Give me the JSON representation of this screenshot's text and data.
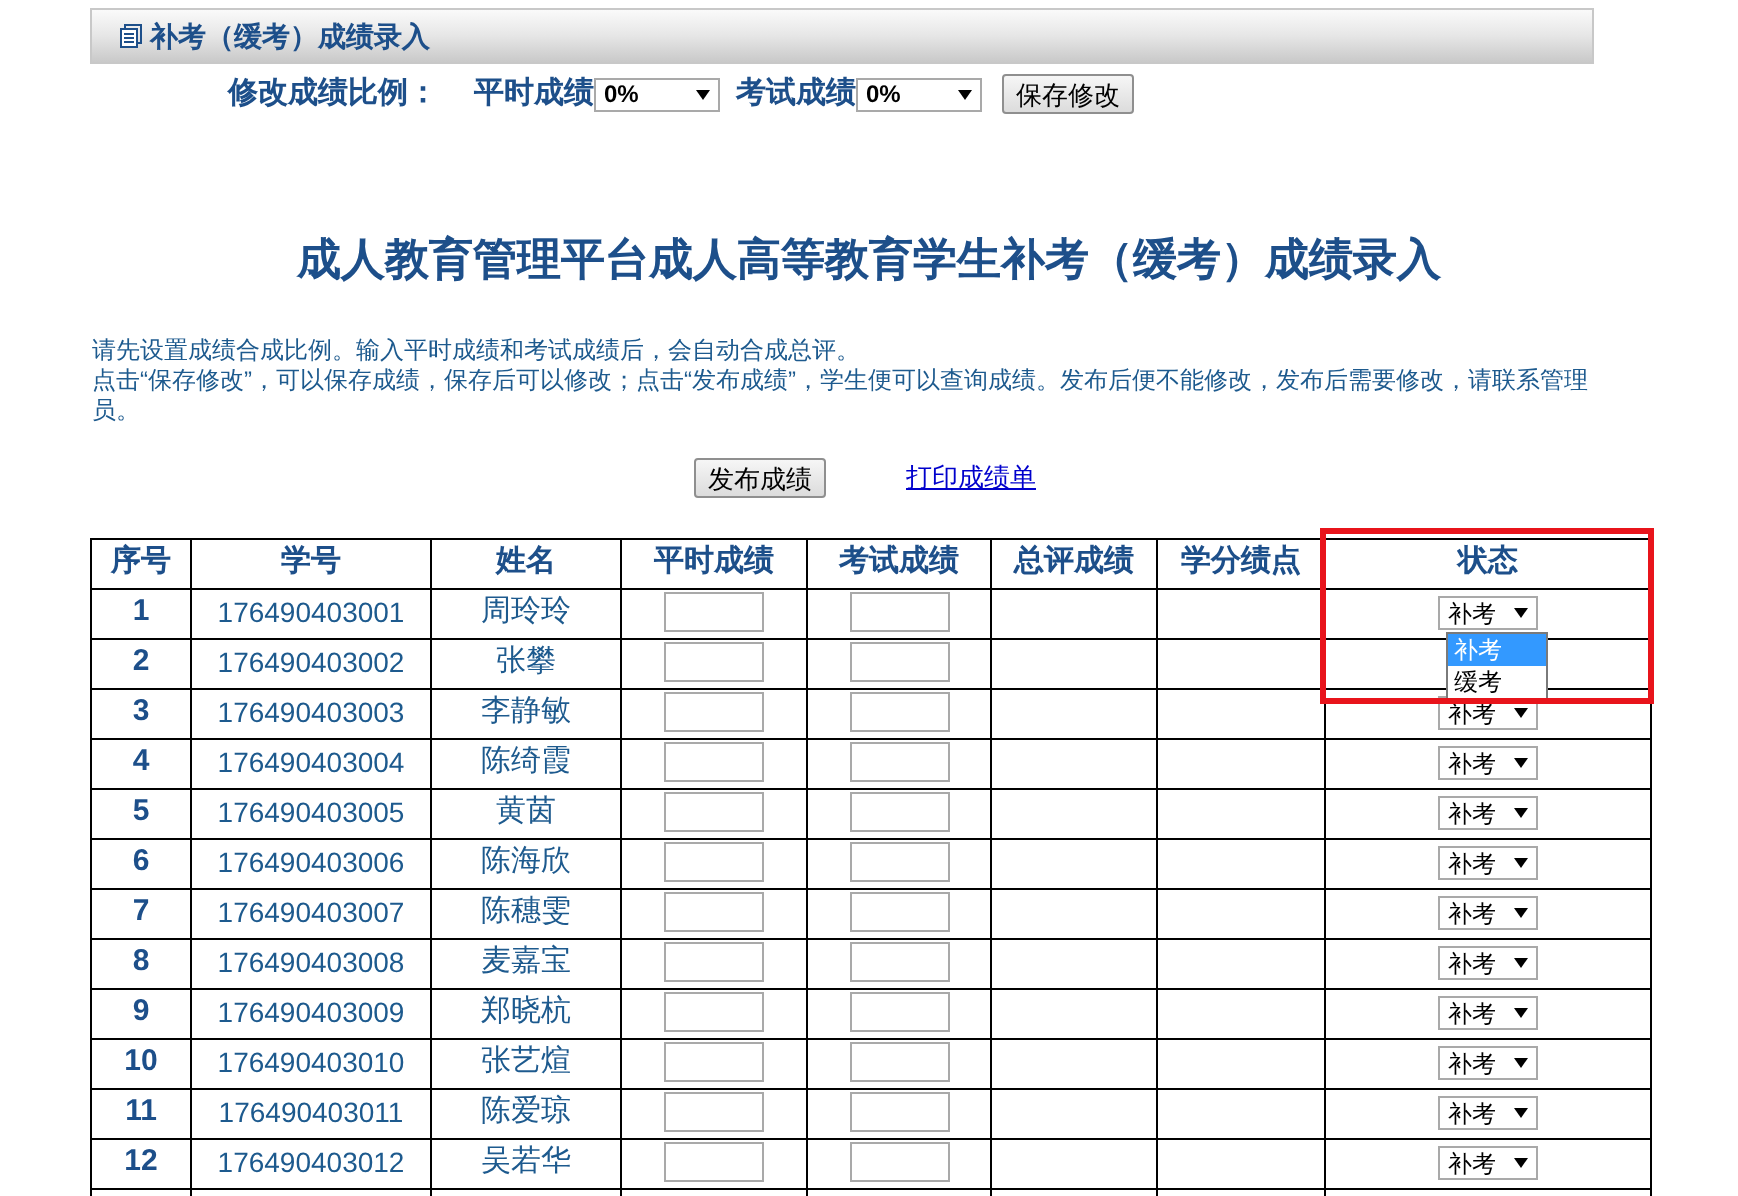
{
  "header": {
    "title": "补考（缓考）成绩录入"
  },
  "ratio": {
    "label": "修改成绩比例：",
    "fields": [
      {
        "label": "平时成绩",
        "value": "0%"
      },
      {
        "label": "考试成绩",
        "value": "0%"
      }
    ],
    "save_button": "保存修改"
  },
  "page_title": "成人教育管理平台成人高等教育学生补考（缓考）成绩录入",
  "instructions": [
    "请先设置成绩合成比例。输入平时成绩和考试成绩后，会自动合成总评。",
    "点击“保存修改”，可以保存成绩，保存后可以修改；点击“发布成绩”，学生便可以查询成绩。发布后便不能修改，发布后需要修改，请联系管理员。"
  ],
  "publish_button": "发布成绩",
  "print_link": "打印成绩单",
  "table": {
    "columns": [
      "序号",
      "学号",
      "姓名",
      "平时成绩",
      "考试成绩",
      "总评成绩",
      "学分绩点",
      "状态"
    ],
    "rows": [
      {
        "no": "1",
        "id": "176490403001",
        "name": "周玲玲",
        "status": "补考",
        "open_options": [
          {
            "label": "补考",
            "selected": true
          },
          {
            "label": "缓考",
            "selected": false
          }
        ]
      },
      {
        "no": "2",
        "id": "176490403002",
        "name": "张攀"
      },
      {
        "no": "3",
        "id": "176490403003",
        "name": "李静敏",
        "status": "补考"
      },
      {
        "no": "4",
        "id": "176490403004",
        "name": "陈绮霞",
        "status": "补考"
      },
      {
        "no": "5",
        "id": "176490403005",
        "name": "黄茵",
        "status": "补考"
      },
      {
        "no": "6",
        "id": "176490403006",
        "name": "陈海欣",
        "status": "补考"
      },
      {
        "no": "7",
        "id": "176490403007",
        "name": "陈穗雯",
        "status": "补考"
      },
      {
        "no": "8",
        "id": "176490403008",
        "name": "麦嘉宝",
        "status": "补考"
      },
      {
        "no": "9",
        "id": "176490403009",
        "name": "郑晓杭",
        "status": "补考"
      },
      {
        "no": "10",
        "id": "176490403010",
        "name": "张艺煊",
        "status": "补考"
      },
      {
        "no": "11",
        "id": "176490403011",
        "name": "陈爱琼",
        "status": "补考"
      },
      {
        "no": "12",
        "id": "176490403012",
        "name": "吴若华",
        "status": "补考"
      }
    ]
  }
}
